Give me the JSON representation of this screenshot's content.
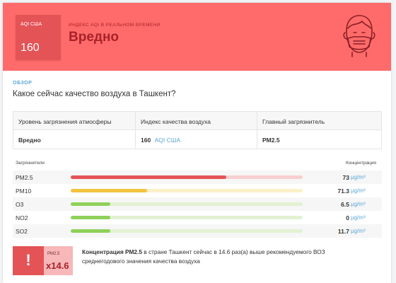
{
  "header": {
    "aqi_label": "AQI США",
    "aqi_value": "160",
    "subtitle": "Индекс AQI в реальном времени",
    "status": "Вредно",
    "color": "#ff6b6b",
    "icon": "face-mask-icon"
  },
  "overview": {
    "tag": "ОБЗОР",
    "question": "Какое сейчас качество воздуха в Ташкент?"
  },
  "summary": {
    "headers": [
      "Уровень загрязнения атмосферы",
      "Индекс качества воздуха",
      "Главный загрязнитель"
    ],
    "level": "Вредно",
    "aqi_number": "160",
    "aqi_unit": "AQI США",
    "main_pollutant": "PM2.5"
  },
  "pollutants": {
    "col_left": "Загрязнители",
    "col_right": "Концентрация",
    "unit": "μg/m³",
    "rows": [
      {
        "name": "PM2.5",
        "value": "73",
        "level": 0.67,
        "color": "#e45356",
        "track": "#f8cfd0"
      },
      {
        "name": "PM10",
        "value": "71.3",
        "level": 0.33,
        "color": "#f2c33f",
        "track": "#fbf0c8"
      },
      {
        "name": "O3",
        "value": "6.5",
        "level": 0.17,
        "color": "#8ed15a",
        "track": "#e2f1d2"
      },
      {
        "name": "NO2",
        "value": "0",
        "level": 0.17,
        "color": "#8ed15a",
        "track": "#e2f1d2"
      },
      {
        "name": "SO2",
        "value": "11.7",
        "level": 0.17,
        "color": "#8ed15a",
        "track": "#e2f1d2"
      }
    ]
  },
  "callout": {
    "symbol": "!",
    "pollutant": "PM2.5",
    "multiplier": "x14.6",
    "bold": "Концентрация PM2.5",
    "text": " в стране Ташкент сейчас в 14.6 раз(а) выше рекомендуемого ВОЗ среднегодового значения качества воздуха"
  }
}
